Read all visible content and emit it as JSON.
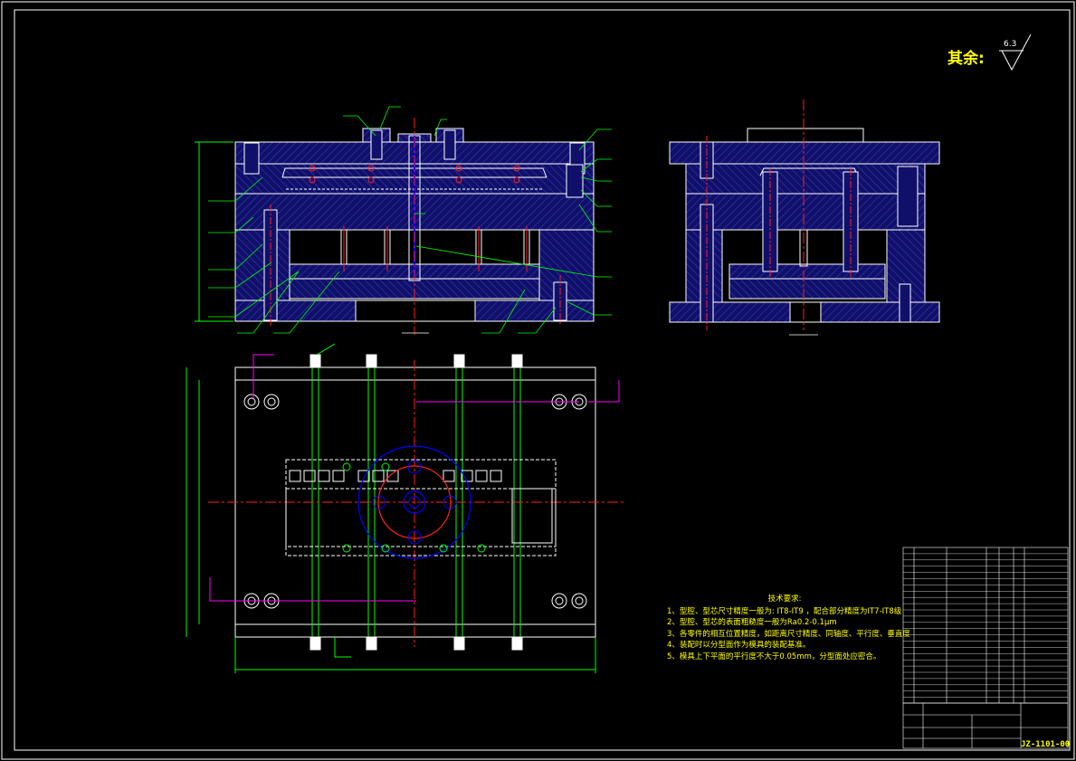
{
  "surface_finish": {
    "label": "其余:",
    "value": "6.3"
  },
  "tech_requirements": {
    "title": "技术要求:",
    "items": [
      "1、型腔、型芯尺寸精度一般为: IT8-IT9 ，配合部分精度为IT7-IT8级",
      "2、型腔、型芯的表面粗糙度一般为Ra0.2-0.1μm",
      "3、各零件的相互位置精度，如距离尺寸精度、同轴度、平行度、垂直度",
      "4、装配时以分型面作为模具的装配基准。",
      "5、模具上下平面的平行度不大于0.05mm，分型面处应密合。"
    ]
  },
  "title_block": {
    "drawing_number": "JZ-1101-00"
  },
  "colors": {
    "background": "#000000",
    "plate_fill": "#10106a",
    "hatch": "#3a3ab0",
    "outline": "#ffffff",
    "dimension": "#00ff00",
    "center_line": "#ff2020",
    "mold_part": "#0000ff",
    "annotation": "#ffff00",
    "section_marker": "#ff00ff"
  }
}
